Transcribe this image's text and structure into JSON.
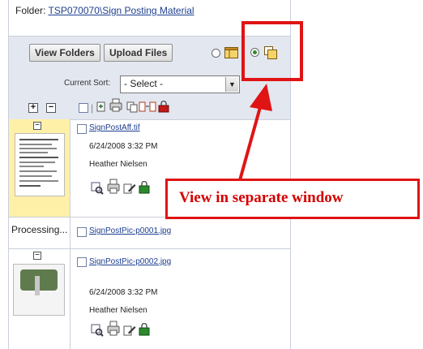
{
  "header": {
    "folder_label": "Folder:",
    "folder_path": "TSP070070\\Sign Posting Material"
  },
  "toolbar": {
    "view_folders": "View Folders",
    "upload_files": "Upload Files"
  },
  "sort": {
    "label": "Current Sort:",
    "selected": "- Select -"
  },
  "iconbar": {
    "expand": "+",
    "collapse": "−"
  },
  "files": [
    {
      "name": "SignPostAff.tif",
      "date": "6/24/2008 3:32 PM",
      "author": "Heather Nielsen"
    },
    {
      "name": "SignPostPic-p0001.jpg",
      "status": "Processing..."
    },
    {
      "name": "SignPostPic-p0002.jpg",
      "date": "6/24/2008 3:32 PM",
      "author": "Heather Nielsen"
    }
  ],
  "annotation": {
    "callout": "View in separate window"
  },
  "colors": {
    "accent": "#e01414",
    "link": "#1d3f8f",
    "panel": "#e3e7f0",
    "selected_thumb": "#fff0a8"
  }
}
